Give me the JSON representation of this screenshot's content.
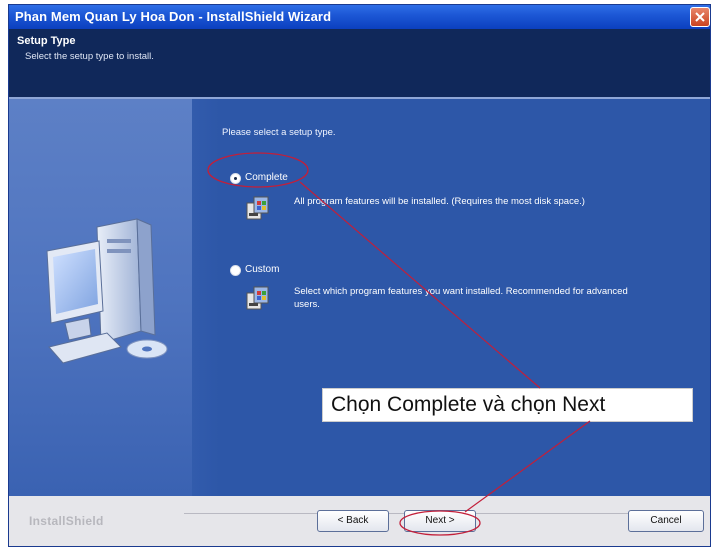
{
  "window": {
    "title": "Phan Mem Quan Ly Hoa Don - InstallShield Wizard"
  },
  "header": {
    "title": "Setup Type",
    "subtitle": "Select the setup type to install."
  },
  "main": {
    "prompt": "Please select a setup type.",
    "options": [
      {
        "label": "Complete",
        "selected": true,
        "description": "All program features will be installed. (Requires the most disk space.)"
      },
      {
        "label": "Custom",
        "selected": false,
        "description_line1": "Select which program features you want installed. Recommended for advanced",
        "description_line2": "users."
      }
    ]
  },
  "annotation": {
    "text": "Chọn Complete và chọn Next",
    "color": "#c21f3a"
  },
  "footer": {
    "brand": "InstallShield",
    "back_label": "< Back",
    "next_label": "Next >",
    "cancel_label": "Cancel"
  },
  "colors": {
    "titlebar": "#1d58d6",
    "header_bg": "#10285a",
    "body_bg": "#2d57a8",
    "footer_bg": "#e6e6ea"
  }
}
